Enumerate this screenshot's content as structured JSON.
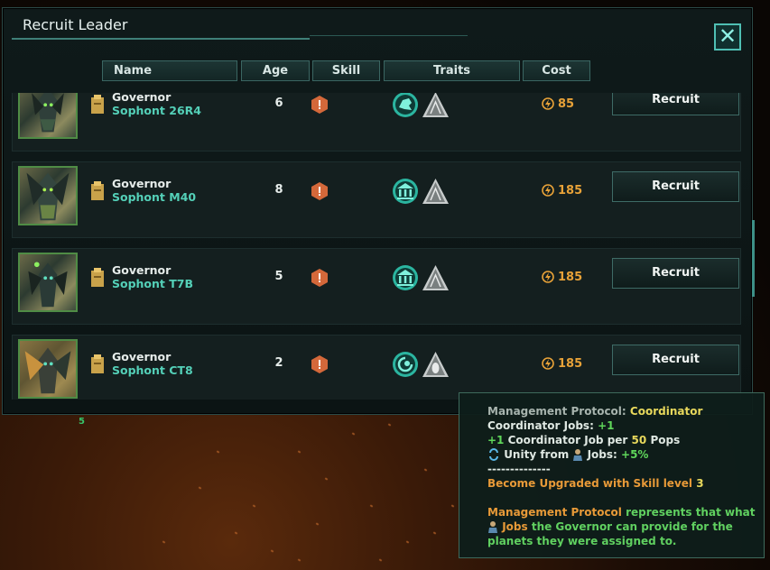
{
  "window": {
    "title": "Recruit Leader",
    "close_icon": "close-icon"
  },
  "columns": {
    "name": "Name",
    "age": "Age",
    "skill": "Skill",
    "traits": "Traits",
    "cost": "Cost"
  },
  "leaders": [
    {
      "class": "Governor",
      "name": "Sophont 26R4",
      "age": "6",
      "trait_icon": "dragon-trait-icon",
      "cost": "85",
      "recruit": "Recruit"
    },
    {
      "class": "Governor",
      "name": "Sophont M40",
      "age": "8",
      "trait_icon": "bank-trait-icon",
      "cost": "185",
      "recruit": "Recruit"
    },
    {
      "class": "Governor",
      "name": "Sophont T7B",
      "age": "5",
      "trait_icon": "bank-trait-icon",
      "cost": "185",
      "recruit": "Recruit"
    },
    {
      "class": "Governor",
      "name": "Sophont CT8",
      "age": "2",
      "trait_icon": "spiral-trait-icon",
      "cost": "185",
      "recruit": "Recruit"
    }
  ],
  "background_number": "5",
  "tooltip": {
    "protocol_label": "Management Protocol:",
    "protocol_value": "Coordinator",
    "jobs_label": "Coordinator Jobs:",
    "jobs_value": "+1",
    "per_prefix": "+1",
    "per_text": "Coordinator Job per",
    "per_value": "50",
    "per_suffix": "Pops",
    "unity_text": "Unity from",
    "unity_jobs": "Jobs:",
    "unity_value": "+5%",
    "separator": "--------------",
    "upgrade_text": "Become Upgraded with Skill level",
    "upgrade_level": "3",
    "desc_1a": "Management Protocol",
    "desc_1b": "represents that what",
    "desc_2a": "Jobs",
    "desc_2b": "the Governor can provide for the",
    "desc_3": "planets they were assigned to."
  },
  "colors": {
    "accent": "#4fc0b4",
    "cost": "#e8a238",
    "subname": "#54d0b8",
    "positive": "#5fd65a"
  }
}
